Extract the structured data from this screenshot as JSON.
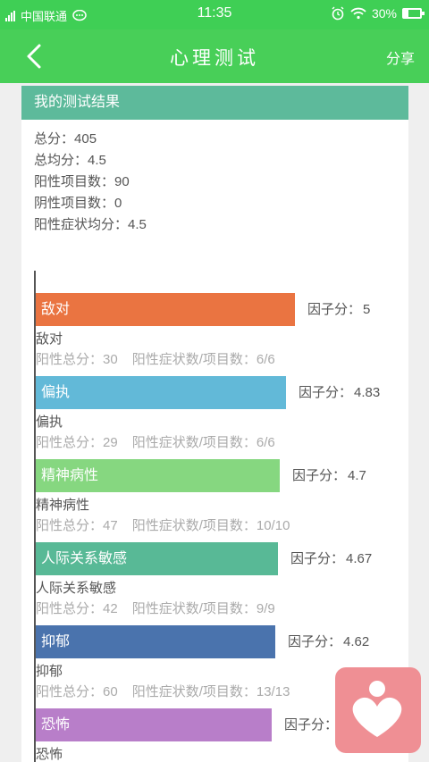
{
  "status_bar": {
    "carrier": "中国联通",
    "network": "4G",
    "time": "11:35",
    "battery": "30%"
  },
  "app_bar": {
    "title": "心理测试",
    "share": "分享"
  },
  "result_card": {
    "header": "我的测试结果",
    "summary": [
      {
        "label": "总分：",
        "value": "405"
      },
      {
        "label": "总均分：",
        "value": "4.5"
      },
      {
        "label": "阳性项目数：",
        "value": "90"
      },
      {
        "label": "阴性项目数：",
        "value": "0"
      },
      {
        "label": "阳性症状均分：",
        "value": "4.5"
      }
    ]
  },
  "labels": {
    "factor_score": "因子分：",
    "positive_total": "阳性总分：",
    "positive_ratio": "阳性症状数/项目数："
  },
  "chart_data": {
    "type": "bar",
    "orientation": "horizontal",
    "categories": [
      "敌对",
      "偏执",
      "精神病性",
      "人际关系敏感",
      "抑郁",
      "恐怖"
    ],
    "values": [
      5,
      4.83,
      4.7,
      4.67,
      4.62,
      4.56
    ],
    "colors": [
      "#ea7441",
      "#62b9d8",
      "#86d780",
      "#58b996",
      "#4a73ad",
      "#b87ec9"
    ]
  },
  "factors": [
    {
      "name": "敌对",
      "score": "5",
      "positive_total": "30",
      "ratio": "6/6"
    },
    {
      "name": "偏执",
      "score": "4.83",
      "positive_total": "29",
      "ratio": "6/6"
    },
    {
      "name": "精神病性",
      "score": "4.7",
      "positive_total": "47",
      "ratio": "10/10"
    },
    {
      "name": "人际关系敏感",
      "score": "4.67",
      "positive_total": "42",
      "ratio": "9/9"
    },
    {
      "name": "抑郁",
      "score": "4.62",
      "positive_total": "60",
      "ratio": "13/13"
    },
    {
      "name": "恐怖",
      "score": "",
      "positive_total": "",
      "ratio": ""
    }
  ]
}
